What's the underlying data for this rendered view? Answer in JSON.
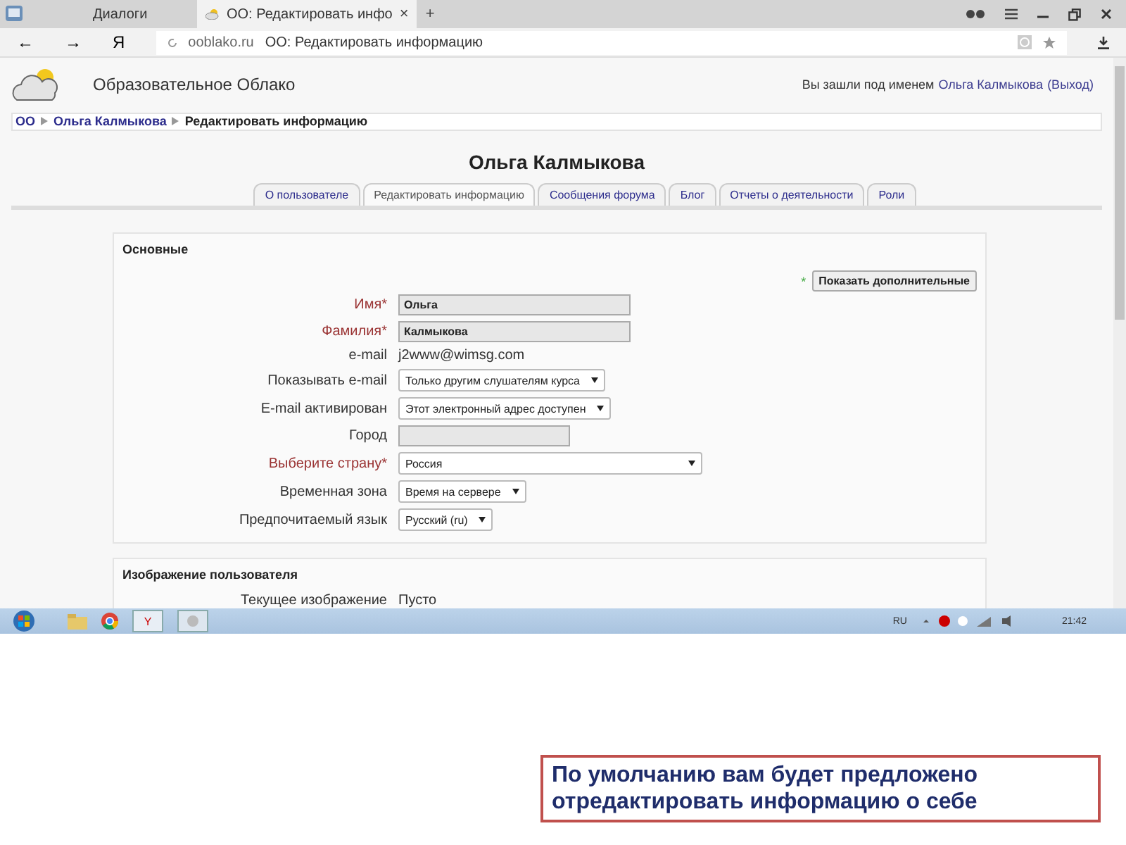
{
  "browser": {
    "tabs": [
      {
        "label": "Диалоги",
        "selected": false
      },
      {
        "label": "ОО: Редактировать инфо",
        "selected": true,
        "close": "×"
      }
    ],
    "new_tab": "+",
    "nav": {
      "back": "←",
      "forward": "→",
      "yandex": "Я"
    },
    "address": {
      "domain": "ooblako.ru",
      "title": "ОО: Редактировать информацию"
    }
  },
  "header": {
    "site_name": "Образовательное Облако",
    "login_prefix": "Вы зашли под именем",
    "login_user": "Ольга Калмыкова",
    "logout": "(Выход)"
  },
  "breadcrumbs": [
    {
      "label": "ОО",
      "link": true
    },
    {
      "label": "Ольга Калмыкова",
      "link": true
    },
    {
      "label": "Редактировать информацию",
      "link": false
    }
  ],
  "page_title": "Ольга Калмыкова",
  "profile_tabs": [
    {
      "label": "О пользователе",
      "selected": false
    },
    {
      "label": "Редактировать информацию",
      "selected": true
    },
    {
      "label": "Сообщения форума",
      "selected": false
    },
    {
      "label": "Блог",
      "selected": false
    },
    {
      "label": "Отчеты о деятельности",
      "selected": false
    },
    {
      "label": "Роли",
      "selected": false
    }
  ],
  "section": {
    "legend": "Основные",
    "required_mark": "*",
    "show_more": "Показать дополнительные",
    "fields": [
      {
        "label": "Имя*",
        "required": true,
        "kind": "text",
        "value": "Ольга"
      },
      {
        "label": "Фамилия*",
        "required": true,
        "kind": "text",
        "value": "Калмыкова"
      },
      {
        "label": "e-mail",
        "required": false,
        "kind": "static",
        "value": "j2www@wimsg.com"
      },
      {
        "label": "Показывать e-mail",
        "required": false,
        "kind": "select",
        "value": "Только другим слушателям курса"
      },
      {
        "label": "E-mail активирован",
        "required": false,
        "kind": "select",
        "value": "Этот электронный адрес доступен"
      },
      {
        "label": "Город",
        "required": false,
        "kind": "text"
      },
      {
        "label": "Выберите страну*",
        "required": true,
        "kind": "select",
        "value": "Россия"
      },
      {
        "label": "Временная зона",
        "required": false,
        "kind": "select",
        "value": "Время на сервере"
      },
      {
        "label": "Предпочитаемый язык",
        "required": false,
        "kind": "select",
        "value": "Русский (ru)"
      }
    ]
  },
  "section2": {
    "legend": "Изображение пользователя",
    "fields": [
      {
        "label": "Текущее изображение",
        "value": "Пусто"
      }
    ]
  },
  "taskbar": {
    "yandex": "Y",
    "language": "RU",
    "time": "21:42"
  },
  "caption": "По умолчанию вам будет предложено отредактировать информацию о себе"
}
